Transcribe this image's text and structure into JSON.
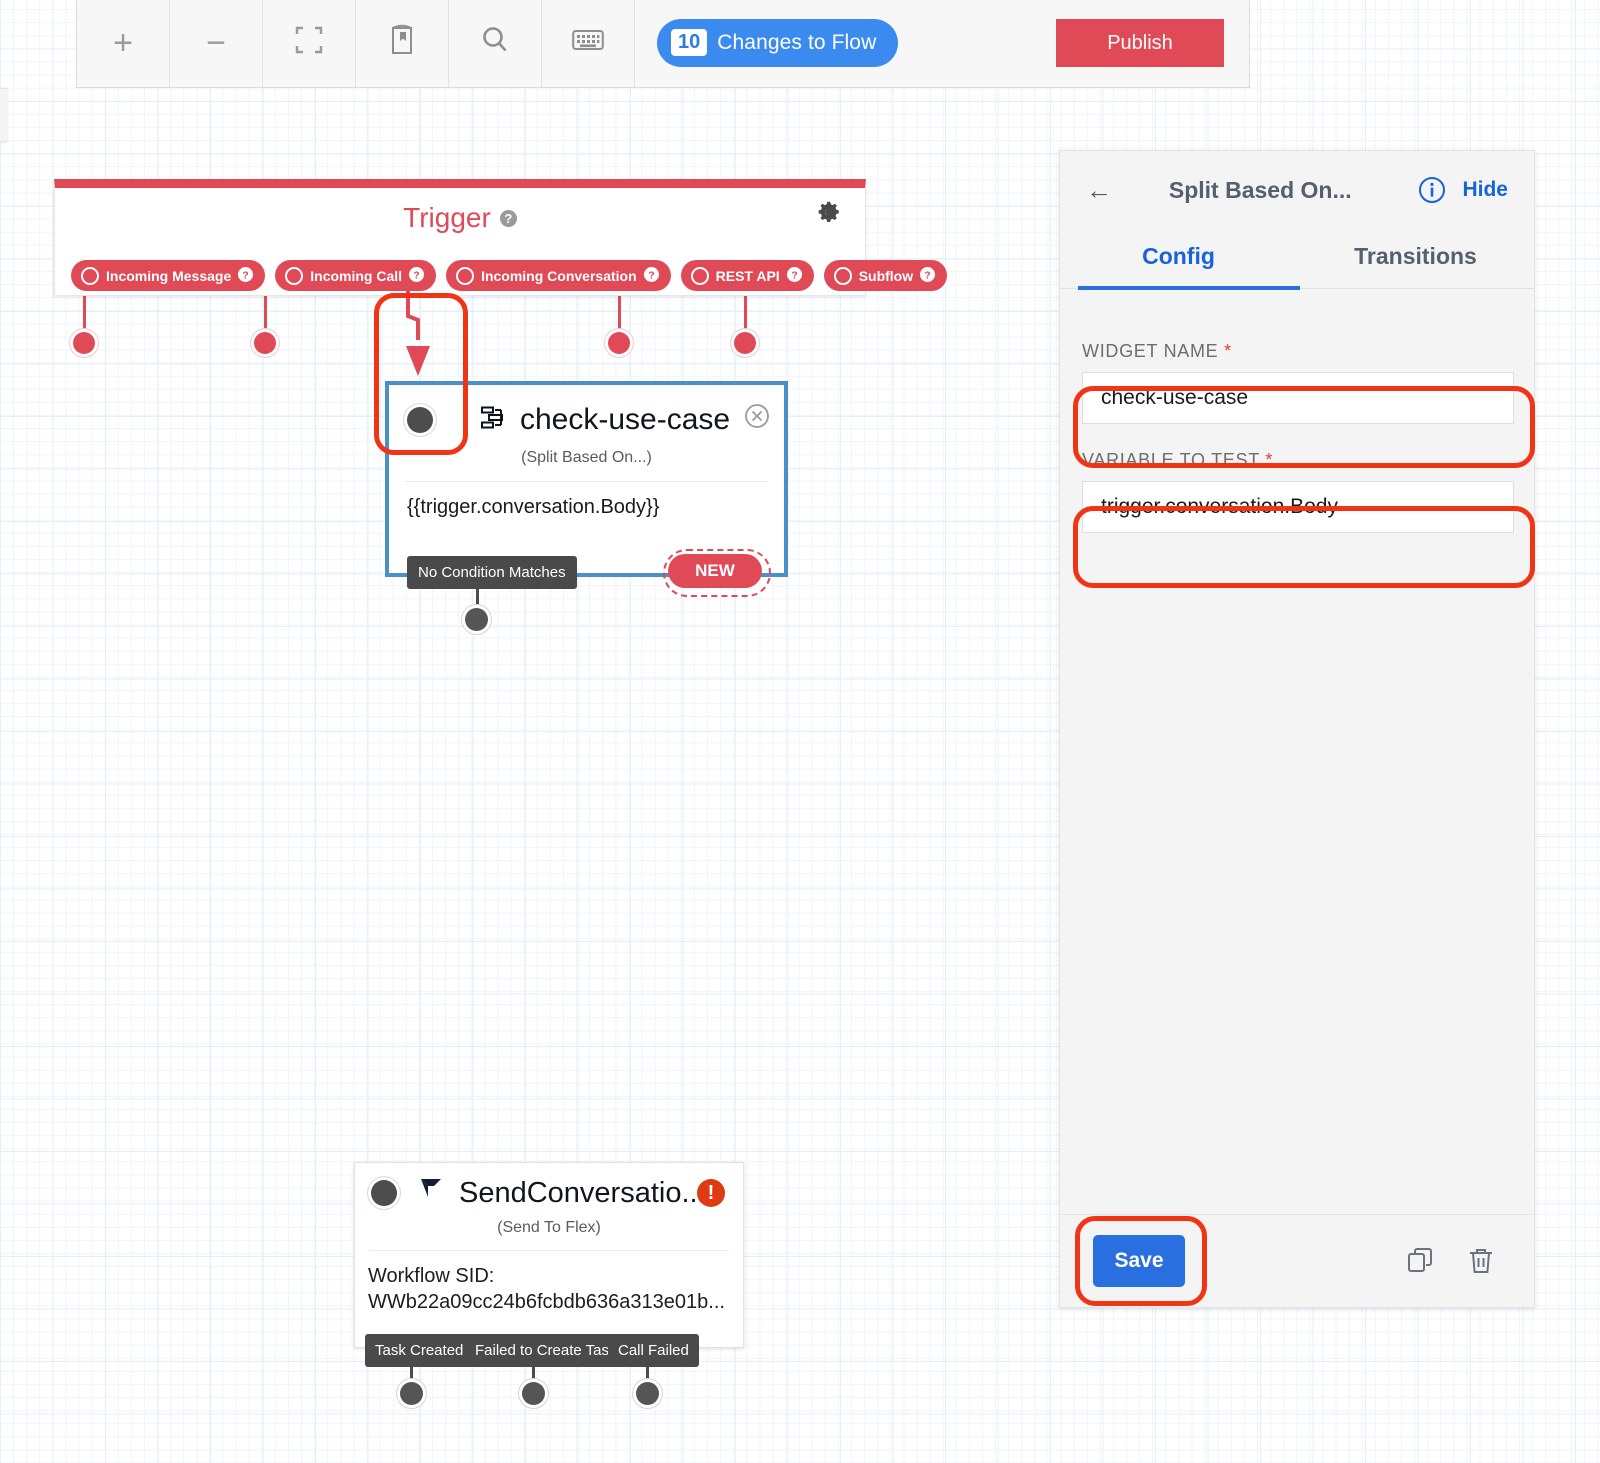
{
  "toolbar": {
    "zoom_in_label": "+",
    "zoom_out_label": "−",
    "fit_icon": "fit-screen-icon",
    "library_icon": "widget-library-icon",
    "search_icon": "search-icon",
    "keyboard_icon": "keyboard-icon",
    "changes_count": "10",
    "changes_label": "Changes to Flow",
    "publish_label": "Publish"
  },
  "trigger": {
    "title": "Trigger",
    "help_glyph": "?",
    "gear_icon": "gear-icon",
    "pills": [
      {
        "label": "Incoming Message"
      },
      {
        "label": "Incoming Call"
      },
      {
        "label": "Incoming Conversation"
      },
      {
        "label": "REST API"
      },
      {
        "label": "Subflow"
      }
    ]
  },
  "split_node": {
    "icon": "split-based-on-icon",
    "title": "check-use-case",
    "subtitle": "(Split Based On...)",
    "expression": "{{trigger.conversation.Body}}",
    "close_glyph": "×",
    "no_condition_label": "No Condition Matches",
    "new_label": "NEW"
  },
  "flex_node": {
    "icon": "twilio-flex-icon",
    "title": "SendConversatio...",
    "subtitle": "(Send To Flex)",
    "body_line1": "Workflow SID:",
    "body_line2": "WWb22a09cc24b6fcbdb636a313e01b...",
    "error_glyph": "!",
    "outputs": [
      {
        "label": "Task Created"
      },
      {
        "label": "Failed to Create Task"
      },
      {
        "label": "Call Failed"
      }
    ]
  },
  "panel": {
    "back_glyph": "←",
    "title": "Split Based On...",
    "info_icon": "info-icon",
    "hide_label": "Hide",
    "collapse_glyph": "«",
    "tabs": [
      {
        "label": "Config",
        "active": true
      },
      {
        "label": "Transitions",
        "active": false
      }
    ],
    "fields": [
      {
        "label": "WIDGET NAME",
        "required_marker": "*",
        "value": "check-use-case"
      },
      {
        "label": "VARIABLE TO TEST",
        "required_marker": "*",
        "value": "trigger.conversation.Body"
      }
    ],
    "save_label": "Save",
    "duplicate_icon": "duplicate-icon",
    "delete_icon": "trash-icon"
  },
  "colors": {
    "brand_red": "#e04a56",
    "annotation_red": "#f03517",
    "primary_blue": "#2a6fe0",
    "badge_blue": "#3a8af0",
    "node_border_blue": "#4a90c4",
    "chip_gray": "#4a4a4a",
    "error_orange": "#dd3b13"
  }
}
